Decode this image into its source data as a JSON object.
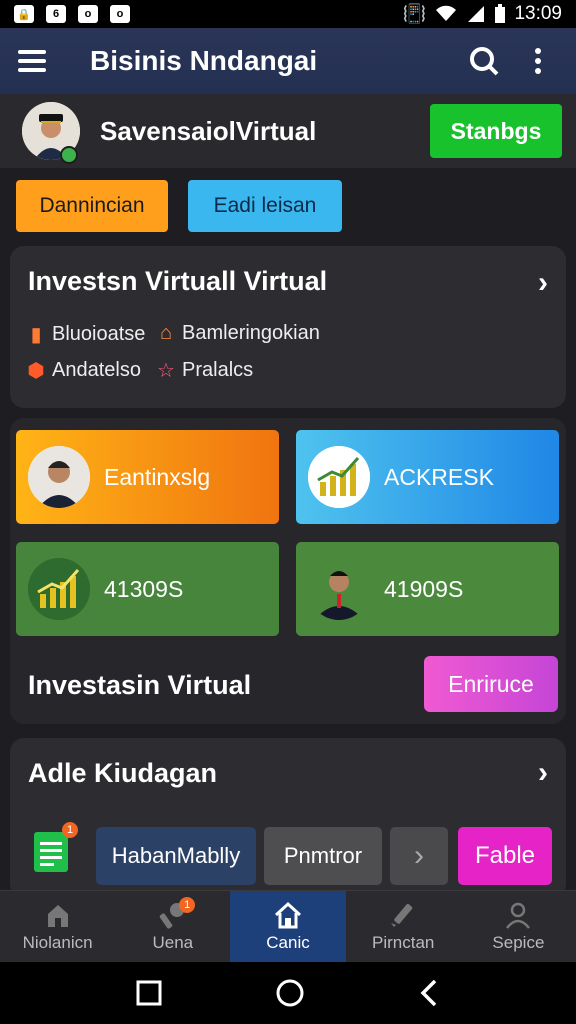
{
  "status_bar": {
    "time": "13:09",
    "left_icons": [
      "lock-icon",
      "notification-icon",
      "notification-icon",
      "notification-icon"
    ],
    "right_icons": [
      "vibrate-icon",
      "wifi-icon",
      "signal-icon",
      "battery-icon"
    ]
  },
  "app_bar": {
    "title": "Bisinis Nndangai",
    "actions": [
      "search-icon",
      "more-vert-icon"
    ]
  },
  "profile": {
    "name": "SavensaiolVirtual",
    "button_label": "Stanbgs"
  },
  "chips": [
    "Dannincian",
    "Eadi leisan"
  ],
  "card_investasi": {
    "title": "Investsn Virtuall Virtual",
    "tags": [
      {
        "icon": "document-icon",
        "label": "Bluoioatse"
      },
      {
        "icon": "home-icon",
        "label": "Bamleringokian"
      },
      {
        "icon": "hexagon-icon",
        "label": "Andatelso"
      },
      {
        "icon": "star-icon",
        "label": "Pralalcs"
      }
    ]
  },
  "tiles": [
    {
      "label": "Eantinxslg",
      "icon": "person-avatar-icon"
    },
    {
      "label": "ACKRESK",
      "icon": "growth-chart-icon"
    },
    {
      "label": "41309S",
      "icon": "growth-chart-icon"
    },
    {
      "label": "41909S",
      "icon": "person-avatar-icon"
    }
  ],
  "investasi_section": {
    "label": "Investasin Virtual",
    "button_label": "Enriruce"
  },
  "card_adle": {
    "title": "Adle Kiudagan",
    "doc_badge": "1",
    "pills": [
      "HabanMablly",
      "Pnmtror",
      "›",
      "Fable"
    ]
  },
  "bottom_nav": [
    {
      "label": "Niolanicn",
      "icon": "house-icon",
      "active": false
    },
    {
      "label": "Uena",
      "icon": "wrench-icon",
      "active": false,
      "badge": "1"
    },
    {
      "label": "Canic",
      "icon": "home-icon",
      "active": true
    },
    {
      "label": "Pirnctan",
      "icon": "pen-icon",
      "active": false
    },
    {
      "label": "Sepice",
      "icon": "person-icon",
      "active": false
    }
  ],
  "colors": {
    "appbar": "#2a3558",
    "accent_green": "#18c22c",
    "accent_orange": "#ff9f1c",
    "accent_blue": "#39b7ee",
    "accent_pink": "#e623c6"
  }
}
